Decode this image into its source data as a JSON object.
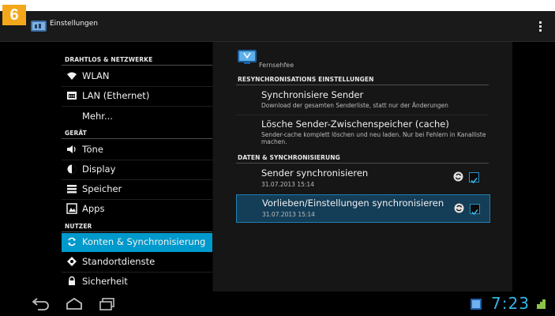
{
  "step_badge": "6",
  "actionbar": {
    "title": "Einstellungen",
    "overflow_icon": "overflow-menu-icon"
  },
  "left_pane": {
    "sections": [
      {
        "header": "DRAHTLOS & NETZWERKE",
        "items": [
          {
            "label": "WLAN",
            "icon": "wifi-icon"
          },
          {
            "label": "LAN (Ethernet)",
            "icon": "ethernet-icon"
          },
          {
            "label": "Mehr...",
            "icon": ""
          }
        ]
      },
      {
        "header": "GERÄT",
        "items": [
          {
            "label": "Töne",
            "icon": "volume-icon"
          },
          {
            "label": "Display",
            "icon": "brightness-icon"
          },
          {
            "label": "Speicher",
            "icon": "storage-icon"
          },
          {
            "label": "Apps",
            "icon": "apps-icon"
          }
        ]
      },
      {
        "header": "NUTZER",
        "items": [
          {
            "label": "Konten & Synchronisierung",
            "icon": "sync-icon",
            "selected": true
          },
          {
            "label": "Standortdienste",
            "icon": "location-icon"
          },
          {
            "label": "Sicherheit",
            "icon": "lock-icon"
          }
        ]
      }
    ]
  },
  "right_pane": {
    "account_label": "Fernsehfee",
    "sections": [
      {
        "header": "RESYNCHRONISATIONS EINSTELLUNGEN",
        "items": [
          {
            "title": "Synchronisiere Sender",
            "summary": "Download der gesamten Senderliste, statt nur der Änderungen"
          },
          {
            "title": "Lösche Sender-Zwischenspeicher (cache)",
            "summary": "Sender-cache komplett löschen und neu laden. Nur bei Fehlern in Kanalliste machen."
          }
        ]
      },
      {
        "header": "DATEN & SYNCHRONISIERUNG",
        "items": [
          {
            "title": "Sender synchronisieren",
            "summary": "31.07.2013 15:14",
            "checked": true
          },
          {
            "title": "Vorlieben/Einstellungen synchronisieren",
            "summary": "31.07.2013 15:14",
            "checked": true,
            "highlighted": true
          }
        ]
      }
    ]
  },
  "system_bar": {
    "clock": "7:23",
    "accent": "#33b5e5"
  },
  "colors": {
    "selection": "#0099cc",
    "highlight": "#143d57",
    "badge": "#f2a81a"
  }
}
